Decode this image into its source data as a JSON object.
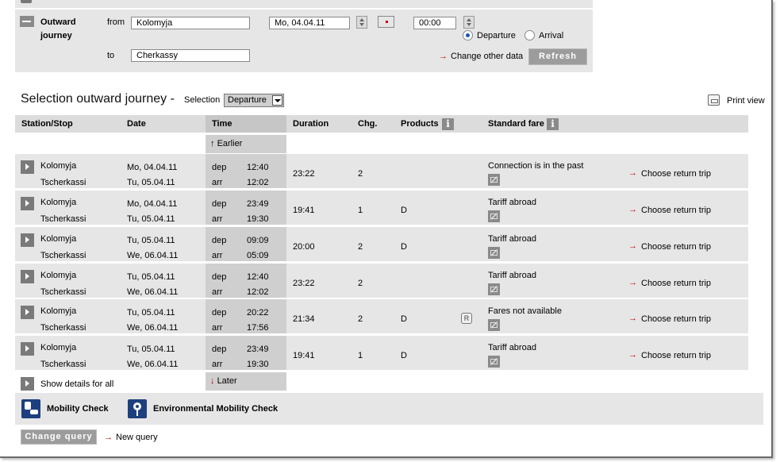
{
  "search": {
    "outward_label_line1": "Outward",
    "outward_label_line2": "journey",
    "from_label": "from",
    "from_value": "Kolomyja",
    "to_label": "to",
    "to_value": "Cherkassy",
    "date_value": "Mo, 04.04.11",
    "time_value": "00:00",
    "departure_label": "Departure",
    "arrival_label": "Arrival",
    "departure_selected": true,
    "change_other_label": "Change other data",
    "refresh_label": "Refresh"
  },
  "results": {
    "title": "Selection outward journey",
    "title_separator": "-",
    "selection_label": "Selection",
    "selection_value": "Departure",
    "print_label": "Print view",
    "columns": {
      "station": "Station/Stop",
      "date": "Date",
      "time": "Time",
      "duration": "Duration",
      "changes": "Chg.",
      "products": "Products",
      "fare": "Standard fare"
    },
    "earlier_label": "Earlier",
    "later_label": "Later",
    "show_details_label": "Show details for all",
    "choose_return_label": "Choose return trip",
    "rows": [
      {
        "from": "Kolomyja",
        "to": "Tscherkassi",
        "date_dep": "Mo, 04.04.11",
        "date_arr": "Tu, 05.04.11",
        "dep_label": "dep",
        "dep_time": "12:40",
        "arr_label": "arr",
        "arr_time": "12:02",
        "duration": "23:22",
        "changes": "2",
        "products": "",
        "fare": "Connection is in the past",
        "reservation_icon": false
      },
      {
        "from": "Kolomyja",
        "to": "Tscherkassi",
        "date_dep": "Mo, 04.04.11",
        "date_arr": "Tu, 05.04.11",
        "dep_label": "dep",
        "dep_time": "23:49",
        "arr_label": "arr",
        "arr_time": "19:30",
        "duration": "19:41",
        "changes": "1",
        "products": "D",
        "fare": "Tariff abroad",
        "reservation_icon": false
      },
      {
        "from": "Kolomyja",
        "to": "Tscherkassi",
        "date_dep": "Tu, 05.04.11",
        "date_arr": "We, 06.04.11",
        "dep_label": "dep",
        "dep_time": "09:09",
        "arr_label": "arr",
        "arr_time": "05:09",
        "duration": "20:00",
        "changes": "2",
        "products": "D",
        "fare": "Tariff abroad",
        "reservation_icon": false
      },
      {
        "from": "Kolomyja",
        "to": "Tscherkassi",
        "date_dep": "Tu, 05.04.11",
        "date_arr": "We, 06.04.11",
        "dep_label": "dep",
        "dep_time": "12:40",
        "arr_label": "arr",
        "arr_time": "12:02",
        "duration": "23:22",
        "changes": "2",
        "products": "",
        "fare": "Tariff abroad",
        "reservation_icon": false
      },
      {
        "from": "Kolomyja",
        "to": "Tscherkassi",
        "date_dep": "Tu, 05.04.11",
        "date_arr": "We, 06.04.11",
        "dep_label": "dep",
        "dep_time": "20:22",
        "arr_label": "arr",
        "arr_time": "17:56",
        "duration": "21:34",
        "changes": "2",
        "products": "D",
        "fare": "Fares not available",
        "reservation_icon": true
      },
      {
        "from": "Kolomyja",
        "to": "Tscherkassi",
        "date_dep": "Tu, 05.04.11",
        "date_arr": "We, 06.04.11",
        "dep_label": "dep",
        "dep_time": "23:49",
        "arr_label": "arr",
        "arr_time": "19:30",
        "duration": "19:41",
        "changes": "1",
        "products": "D",
        "fare": "Tariff abroad",
        "reservation_icon": false
      }
    ]
  },
  "mobility": {
    "mobility_check_label": "Mobility Check",
    "env_check_label": "Environmental Mobility Check"
  },
  "footer": {
    "change_query_label": "Change query",
    "new_query_label": "New query"
  },
  "icons": {
    "arrow_glyph": "→",
    "earlier_glyph": "↑",
    "later_glyph": "↓",
    "info_glyph": "i",
    "reservation_glyph": "R"
  },
  "colors": {
    "accent_red": "#c4000e",
    "panel_grey": "#e6e6e6",
    "button_grey": "#9c9c9c",
    "mobility_blue": "#1d3f7d"
  }
}
